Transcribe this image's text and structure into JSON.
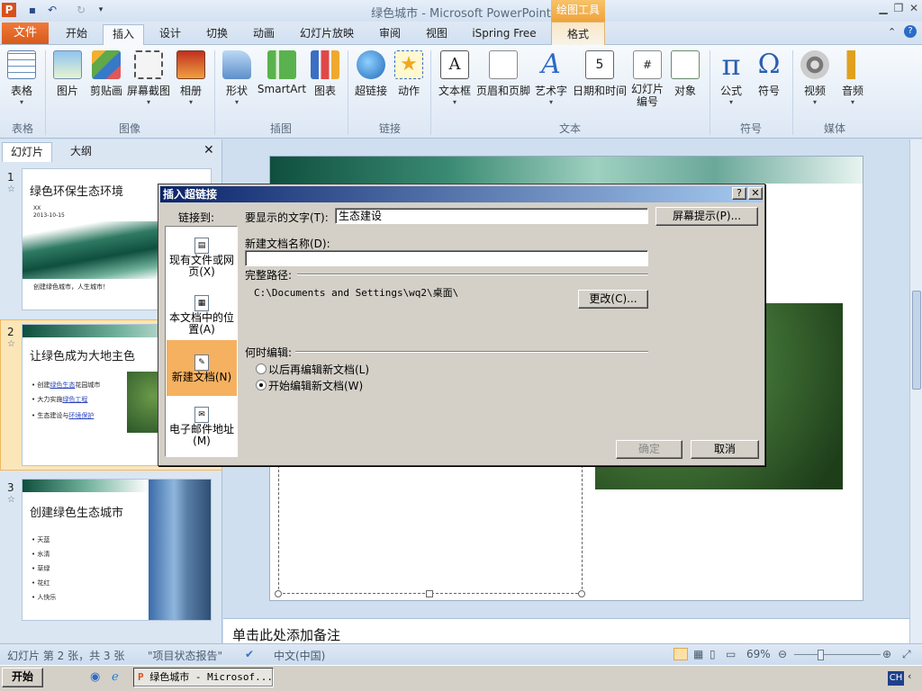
{
  "window": {
    "title": "绿色城市 - Microsoft PowerPoint",
    "drawing_tools": "绘图工具"
  },
  "tabs": {
    "file": "文件",
    "items": [
      "开始",
      "插入",
      "设计",
      "切换",
      "动画",
      "幻灯片放映",
      "审阅",
      "视图",
      "iSpring Free"
    ],
    "format": "格式"
  },
  "ribbon": {
    "buttons": [
      "表格",
      "图片",
      "剪贴画",
      "屏幕截图",
      "相册",
      "形状",
      "SmartArt",
      "图表",
      "超链接",
      "动作",
      "文本框",
      "页眉和页脚",
      "艺术字",
      "日期和时间",
      "幻灯片\n编号",
      "对象",
      "公式",
      "符号",
      "视频",
      "音频"
    ],
    "groups": [
      "表格",
      "图像",
      "插图",
      "链接",
      "文本",
      "符号",
      "媒体"
    ]
  },
  "panel": {
    "tab_slides": "幻灯片",
    "tab_outline": "大纲"
  },
  "slides": [
    {
      "num": "1",
      "title": "绿色环保生态环境",
      "sub1": "XX",
      "sub2": "2013-10-15",
      "line": "创建绿色城市，人生城市！",
      "link": "绿色城市"
    },
    {
      "num": "2",
      "title": "让绿色成为大地主色",
      "bullets": [
        {
          "pre": "创建",
          "link": "绿色生态",
          "post": "花园城市"
        },
        {
          "pre": "大力实施",
          "link": "绿色工程",
          "post": ""
        },
        {
          "pre": "生态建设与",
          "link": "环境保护",
          "post": ""
        }
      ]
    },
    {
      "num": "3",
      "title": "创建绿色生态城市",
      "bullets": [
        "天蓝",
        "水清",
        "草绿",
        "花红",
        "人快乐"
      ]
    }
  ],
  "notes_placeholder": "单击此处添加备注",
  "status": {
    "slide_info": "幻灯片 第 2 张，共 3 张",
    "theme": "\"项目状态报告\"",
    "language": "中文(中国)",
    "zoom": "69%"
  },
  "taskbar": {
    "start": "开始",
    "task": "绿色城市 - Microsof...",
    "ime": "CH"
  },
  "dialog": {
    "title": "插入超链接",
    "link_to": "链接到:",
    "link_options": [
      "现有文件或网页(X)",
      "本文档中的位置(A)",
      "新建文档(N)",
      "电子邮件地址(M)"
    ],
    "display_text_label": "要显示的文字(T):",
    "display_text_value": "生态建设",
    "screentip_button": "屏幕提示(P)...",
    "newdoc_label": "新建文档名称(D):",
    "newdoc_value": "",
    "fullpath_label": "完整路径:",
    "fullpath_value": "C:\\Documents and Settings\\wq2\\桌面\\",
    "change_button": "更改(C)...",
    "when_edit_label": "何时编辑:",
    "radio_later": "以后再编辑新文档(L)",
    "radio_now": "开始编辑新文档(W)",
    "ok": "确定",
    "cancel": "取消"
  },
  "colors": {
    "accent_orange": "#f5b060",
    "file_tab": "#d85a1a",
    "dialog_title": "#0a246a"
  }
}
